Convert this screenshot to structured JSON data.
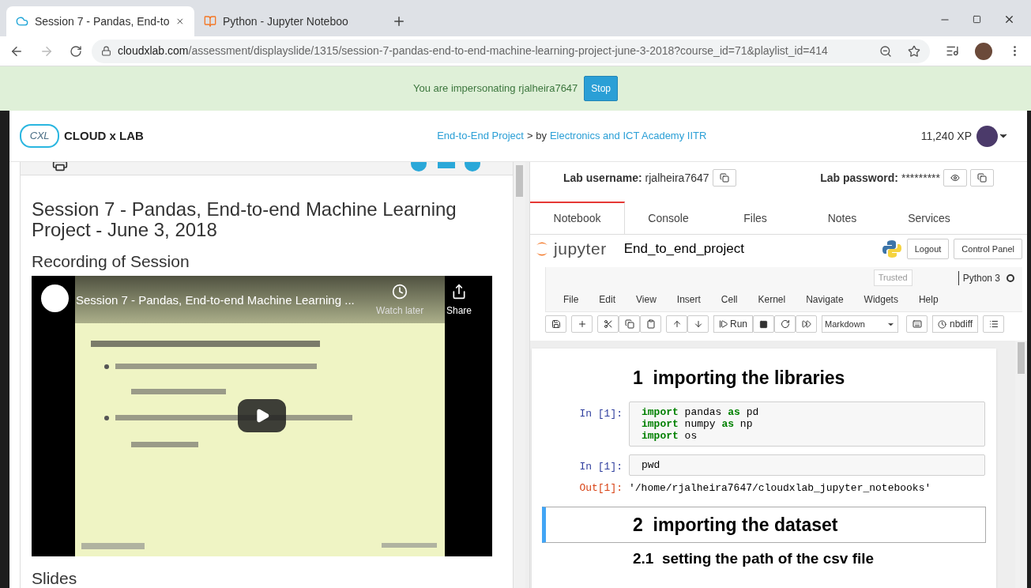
{
  "browser": {
    "tabs": [
      {
        "title": "Session 7 - Pandas, End-to",
        "selected": true
      },
      {
        "title": "Python - Jupyter Noteboo",
        "selected": false
      }
    ],
    "url_host": "cloudxlab.com",
    "url_path": "/assessment/displayslide/1315/session-7-pandas-end-to-end-machine-learning-project-june-3-2018?course_id=71&playlist_id=414"
  },
  "banner": {
    "text": "You are impersonating rjalheira7647",
    "button": "Stop"
  },
  "header": {
    "logo_mark": "CXL",
    "logo_text": "CLOUD x LAB",
    "breadcrumb": [
      {
        "text": "End-to-End Project",
        "kind": "link"
      },
      {
        "text": "> by",
        "kind": "plain"
      },
      {
        "text": "Electronics and ICT Academy IITR",
        "kind": "link"
      }
    ],
    "xp": "11,240 XP"
  },
  "left": {
    "title": "Session 7 - Pandas, End-to-end Machine Learning Project - June 3, 2018",
    "section": "Recording of Session",
    "video": {
      "title": "Session 7 - Pandas, End-to-end Machine Learning ...",
      "watch_later": "Watch later",
      "share": "Share"
    },
    "next_section": "Slides"
  },
  "right": {
    "username_label": "Lab username:",
    "username": "rjalheira7647",
    "password_label": "Lab password:",
    "password": "*********",
    "tabs": [
      {
        "label": "Notebook",
        "selected": true
      },
      {
        "label": "Console",
        "selected": false
      },
      {
        "label": "Files",
        "selected": false
      },
      {
        "label": "Notes",
        "selected": false
      },
      {
        "label": "Services",
        "selected": false
      }
    ],
    "jupyter": {
      "logo": "jupyter",
      "notebook": "End_to_end_project",
      "buttons": [
        "Logout",
        "Control Panel"
      ],
      "trusted": "Trusted",
      "kernel": "Python 3",
      "menus": [
        "File",
        "Edit",
        "View",
        "Insert",
        "Cell",
        "Kernel",
        "Navigate",
        "Widgets",
        "Help"
      ],
      "run": "Run",
      "cell_type": "Markdown",
      "nbdiff": "nbdiff"
    },
    "cells": [
      {
        "kind": "heading",
        "text": "1  importing the libraries",
        "selected": false
      },
      {
        "kind": "code",
        "prompt": "In [1]:",
        "selected": false,
        "lines": [
          [
            {
              "t": "import",
              "keyword": true
            },
            {
              "t": " pandas ",
              "keyword": false
            },
            {
              "t": "as",
              "keyword": true
            },
            {
              "t": " pd",
              "keyword": false
            }
          ],
          [
            {
              "t": "import",
              "keyword": true
            },
            {
              "t": " numpy ",
              "keyword": false
            },
            {
              "t": "as",
              "keyword": true
            },
            {
              "t": " np",
              "keyword": false
            }
          ],
          [
            {
              "t": "import",
              "keyword": true
            },
            {
              "t": " os",
              "keyword": false
            }
          ]
        ]
      },
      {
        "kind": "code",
        "prompt": "In [1]:",
        "selected": false,
        "lines": [
          [
            {
              "t": "pwd",
              "keyword": false
            }
          ]
        ]
      },
      {
        "kind": "output",
        "prompt": "Out[1]:",
        "text": "'/home/rjalheira7647/cloudxlab_jupyter_notebooks'",
        "selected": false
      },
      {
        "kind": "heading",
        "text": "2  importing the dataset",
        "selected": true
      },
      {
        "kind": "subheading",
        "text": "2.1  setting the path of the csv file",
        "selected": false
      }
    ]
  }
}
